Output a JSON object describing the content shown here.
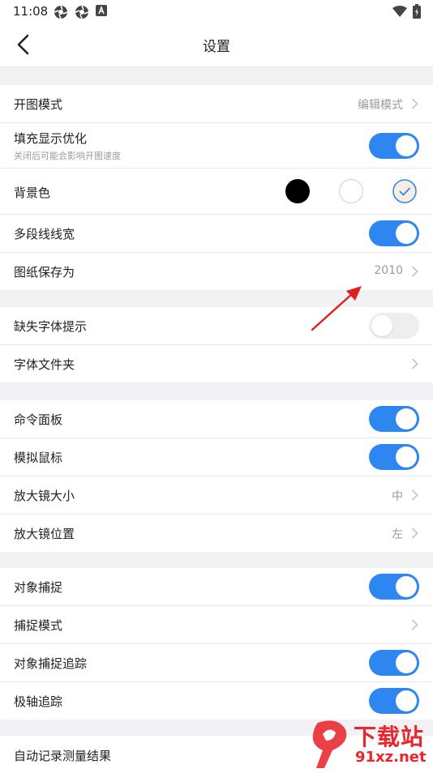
{
  "status_bar": {
    "time": "11:08"
  },
  "header": {
    "title": "设置"
  },
  "sections": [
    {
      "rows": [
        {
          "label": "开图模式",
          "value": "编辑模式"
        },
        {
          "label": "填充显示优化",
          "sublabel": "关闭后可能会影响开图速度",
          "toggle": true
        },
        {
          "label": "背景色",
          "options": [
            "black",
            "white",
            "beige"
          ],
          "selected": "beige"
        },
        {
          "label": "多段线线宽",
          "toggle": true
        },
        {
          "label": "图纸保存为",
          "value": "2010"
        }
      ]
    },
    {
      "rows": [
        {
          "label": "缺失字体提示",
          "toggle": false
        },
        {
          "label": "字体文件夹"
        }
      ]
    },
    {
      "rows": [
        {
          "label": "命令面板",
          "toggle": true
        },
        {
          "label": "模拟鼠标",
          "toggle": true
        },
        {
          "label": "放大镜大小",
          "value": "中"
        },
        {
          "label": "放大镜位置",
          "value": "左"
        }
      ]
    },
    {
      "rows": [
        {
          "label": "对象捕捉",
          "toggle": true
        },
        {
          "label": "捕捉模式"
        },
        {
          "label": "对象捕捉追踪",
          "toggle": true
        },
        {
          "label": "极轴追踪",
          "toggle": true
        }
      ]
    },
    {
      "rows": [
        {
          "label": "自动记录测量结果"
        }
      ]
    }
  ],
  "watermark": {
    "text": "下载站",
    "domain": "91xz.net"
  },
  "colors": {
    "accent": "#2e86f0",
    "toggle_off": "#eeeeef",
    "annotation_arrow": "#e02020"
  }
}
